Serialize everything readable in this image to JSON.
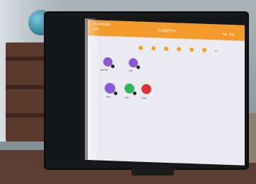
{
  "topbar": {
    "left_line1": "中心监控管理",
    "left_line2": "返回",
    "title": "中心监控平台",
    "right": "切换 · 退出"
  },
  "toolbar": {
    "items": [
      {
        "icon": "person-icon"
      },
      {
        "icon": "gear-icon"
      },
      {
        "icon": "eye-icon"
      },
      {
        "icon": "bell-icon"
      },
      {
        "icon": "lock-icon"
      },
      {
        "icon": "home-icon"
      },
      {
        "icon": "more-icon"
      }
    ]
  },
  "nodes": {
    "row1": [
      {
        "color": "#8b58d4",
        "label": "主控节点"
      },
      {
        "color": "#8b58d4",
        "label": "分控"
      }
    ],
    "row2": [
      {
        "color": "#8b58d4",
        "label": "节点1"
      },
      {
        "color": "#2db35a",
        "label": "节点2"
      },
      {
        "color": "#e0323a",
        "label": "节点3"
      }
    ]
  },
  "colors": {
    "accent": "#f39a2a",
    "screen_bg": "#ebeaf3"
  }
}
